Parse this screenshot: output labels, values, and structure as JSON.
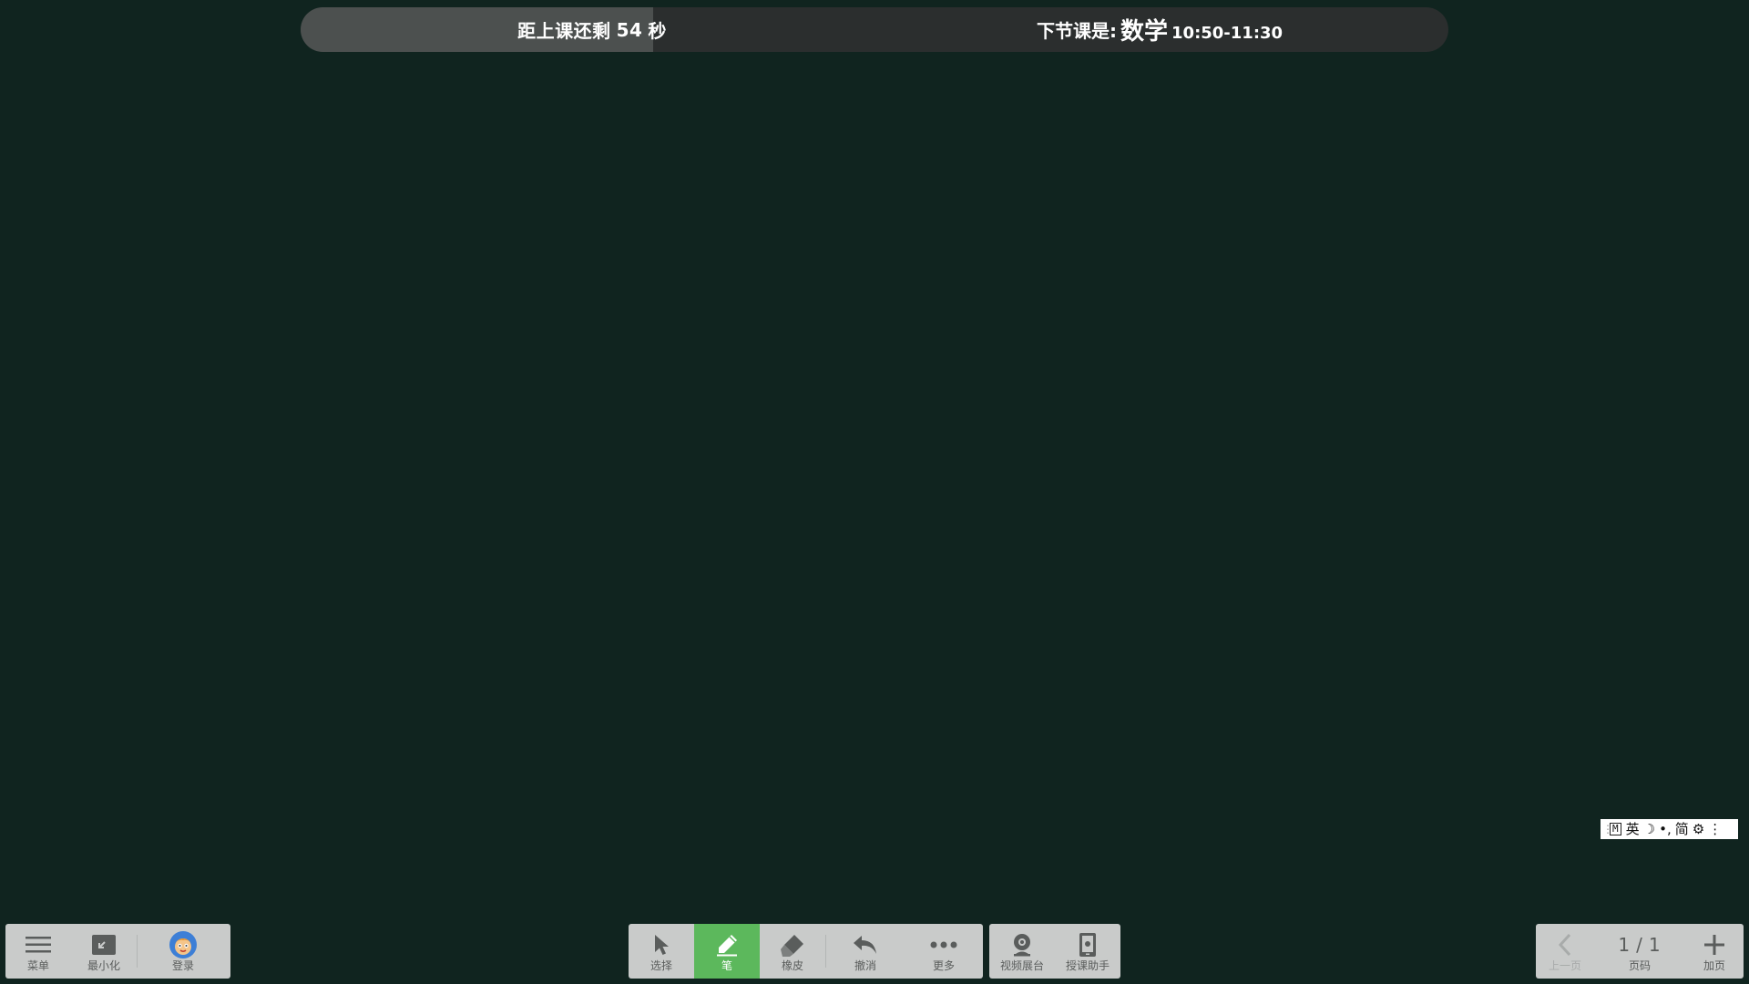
{
  "topbar": {
    "countdown_prefix": "距上课还剩",
    "countdown_seconds": "54",
    "countdown_unit": "秒",
    "next_label": "下节课是:",
    "next_subject": "数学",
    "next_time": "10:50-11:30",
    "progress_fraction": 0.307,
    "progress_color": "#4c504f"
  },
  "ime": {
    "mode_badge": "M",
    "lang": "英",
    "moon_icon": "☽",
    "punct": "•,",
    "script": "简",
    "settings_icon": "⚙",
    "more_icon": "⋮"
  },
  "left_toolbar": {
    "menu_label": "菜单",
    "minimize_label": "最小化",
    "login_label": "登录"
  },
  "center_toolbar": {
    "select_label": "选择",
    "pen_label": "笔",
    "eraser_label": "橡皮",
    "undo_label": "撤消",
    "more_label": "更多",
    "active_tool": "pen",
    "active_color": "#5cb85c"
  },
  "media_toolbar": {
    "camera_label": "视频展台",
    "assistant_label": "授课助手"
  },
  "right_toolbar": {
    "prev_label": "上一页",
    "page_label": "页码",
    "page_current": "1",
    "page_sep": "/",
    "page_total": "1",
    "add_label": "加页"
  },
  "colors": {
    "board_background": "#10241f",
    "toolbar_background": "#c9cbca",
    "topbar_background": "#2b2e2e"
  }
}
